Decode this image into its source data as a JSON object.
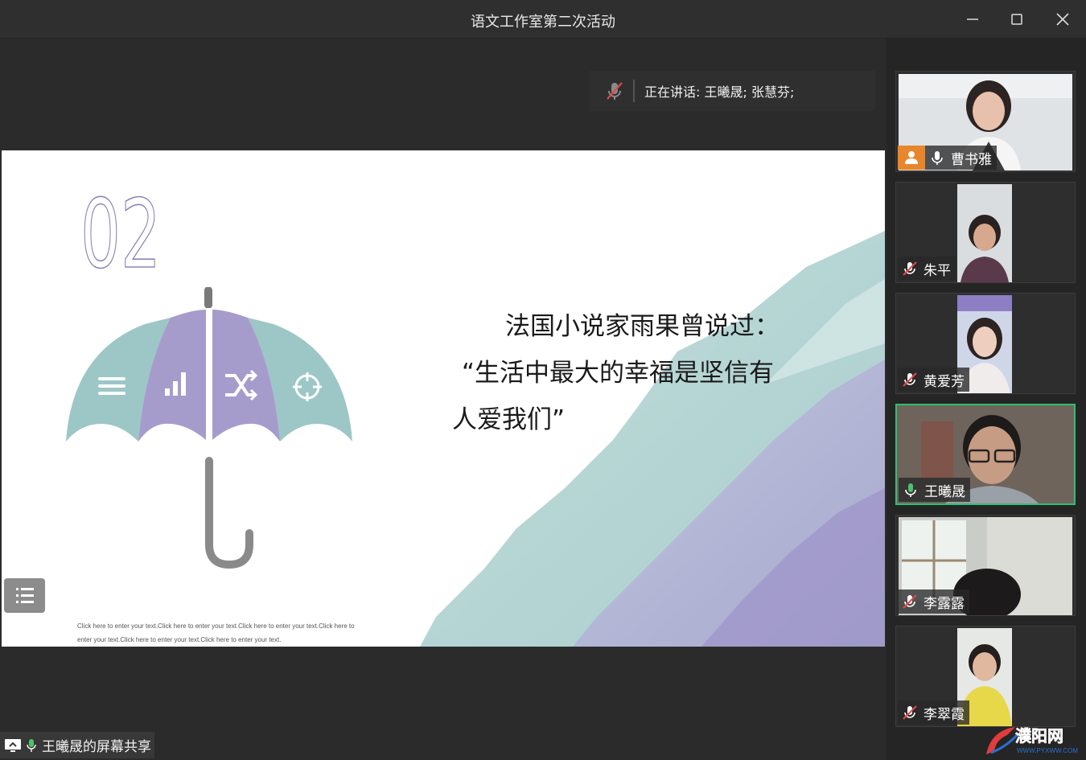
{
  "window": {
    "title": "语文工作室第二次活动"
  },
  "speaking": {
    "text": "正在讲话: 王曦晟; 张慧芬;"
  },
  "slide": {
    "number": "02",
    "quote_line1": "法国小说家雨果曾说过：",
    "quote_line2": "“生活中最大的幸福是坚信有",
    "quote_line3": "人爱我们”",
    "footer_line1": "Click here to enter your text.Click here to enter your text.Click here to enter your text.Click here to",
    "footer_line2": "enter your text.Click here to enter your text.Click here to enter your text."
  },
  "share": {
    "label": "王曦晟的屏幕共享"
  },
  "participants": [
    {
      "name": "曹书雅",
      "mic": "on",
      "host": true
    },
    {
      "name": "朱平",
      "mic": "muted",
      "host": false
    },
    {
      "name": "黄爱芳",
      "mic": "muted",
      "host": false
    },
    {
      "name": "王曦晟",
      "mic": "on",
      "host": false,
      "active": true
    },
    {
      "name": "李露露",
      "mic": "muted",
      "host": false
    },
    {
      "name": "李翠霞",
      "mic": "muted",
      "host": false
    }
  ],
  "watermark": {
    "text": "濮阳网",
    "url": "WWW.PYXWW.COM"
  },
  "colors": {
    "teal": "#9cc7c6",
    "purple": "#a69ccc",
    "active_border": "#2fbf71",
    "host_badge": "#e8862b",
    "mic_muted": "#e24a4a"
  }
}
